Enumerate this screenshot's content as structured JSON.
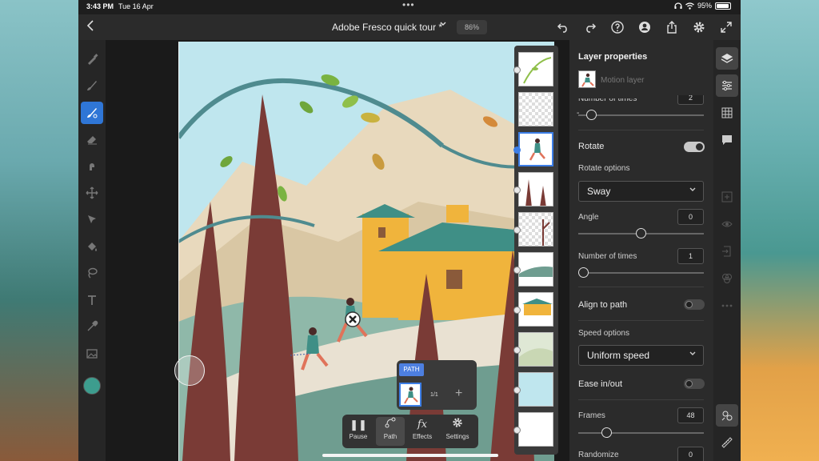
{
  "status_bar": {
    "time": "3:43 PM",
    "date": "Tue 16 Apr",
    "battery": "95%"
  },
  "topbar": {
    "title": "Adobe Fresco quick tour *",
    "zoom": "86%"
  },
  "left_tools": [
    "pixel-brush-icon",
    "live-brush-icon",
    "vector-brush-icon",
    "eraser-icon",
    "smudge-icon",
    "move-icon",
    "selection-icon",
    "fill-icon",
    "lasso-icon",
    "text-icon",
    "eyedropper-icon",
    "image-icon"
  ],
  "current_color": "#3d9d8e",
  "path_popup": {
    "chip": "PATH",
    "count": "1/1",
    "add": "+"
  },
  "motion_controls": {
    "pause": "Pause",
    "path": "Path",
    "effects": "Effects",
    "settings": "Settings"
  },
  "properties": {
    "heading": "Layer properties",
    "layer_name": "Motion layer",
    "number_of_times_top_label": "Number of times",
    "number_of_times_top_value": "2",
    "rotate_label": "Rotate",
    "rotate_on": true,
    "rotate_options_label": "Rotate options",
    "rotate_option": "Sway",
    "angle_label": "Angle",
    "angle_value": "0",
    "number_of_times_label": "Number of times",
    "number_of_times_value": "1",
    "align_to_path_label": "Align to path",
    "align_to_path_on": false,
    "speed_options_label": "Speed options",
    "speed_option": "Uniform speed",
    "ease_label": "Ease in/out",
    "ease_on": false,
    "frames_label": "Frames",
    "frames_value": "48",
    "randomize_label": "Randomize",
    "randomize_value": "0"
  },
  "colors": {
    "accent": "#2f76d6",
    "panel": "#2b2b2b",
    "sky": "#bfe6ee",
    "tree": "#7a3b36",
    "roof": "#3f8f86",
    "house": "#f0b43c"
  }
}
